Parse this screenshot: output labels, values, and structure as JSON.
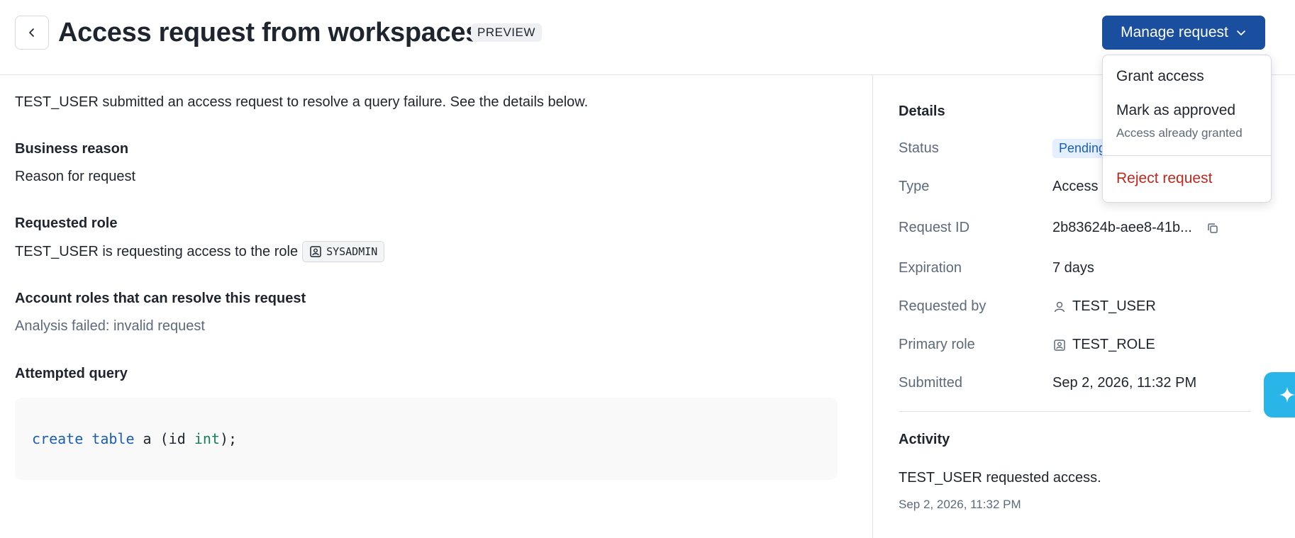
{
  "header": {
    "title": "Access request from workspaces",
    "badge": "PREVIEW",
    "manage_button": "Manage request"
  },
  "main": {
    "intro": "TEST_USER submitted an access request to resolve a query failure. See the details below.",
    "business_reason": {
      "heading": "Business reason",
      "value": "Reason for request"
    },
    "requested_role": {
      "heading": "Requested role",
      "prefix": "TEST_USER is requesting access to the role",
      "role": "SYSADMIN"
    },
    "account_roles": {
      "heading": "Account roles that can resolve this request",
      "value": "Analysis failed: invalid request"
    },
    "attempted_query": {
      "heading": "Attempted query",
      "code": {
        "kw1": "create",
        "kw2": "table",
        "mid": " a (id ",
        "type": "int",
        "end": ");"
      }
    }
  },
  "details": {
    "heading": "Details",
    "status": {
      "label": "Status",
      "value": "Pending"
    },
    "type": {
      "label": "Type",
      "value": "Access"
    },
    "request_id": {
      "label": "Request ID",
      "value": "2b83624b-aee8-41b..."
    },
    "expiration": {
      "label": "Expiration",
      "value": "7 days"
    },
    "requested_by": {
      "label": "Requested by",
      "value": "TEST_USER",
      "icon": "user-icon"
    },
    "primary_role": {
      "label": "Primary role",
      "value": "TEST_ROLE",
      "icon": "role-icon"
    },
    "submitted": {
      "label": "Submitted",
      "value": "Sep 2, 2026, 11:32 PM"
    }
  },
  "activity": {
    "heading": "Activity",
    "text": "TEST_USER requested access.",
    "timestamp": "Sep 2, 2026, 11:32 PM"
  },
  "menu": {
    "grant": "Grant access",
    "approve": "Mark as approved",
    "approve_sub": "Access already granted",
    "reject": "Reject request"
  },
  "colors": {
    "primary": "#1a4fa0",
    "danger": "#c0281e",
    "status_bg": "#e4efff",
    "ai_fab": "#29b5e8"
  }
}
